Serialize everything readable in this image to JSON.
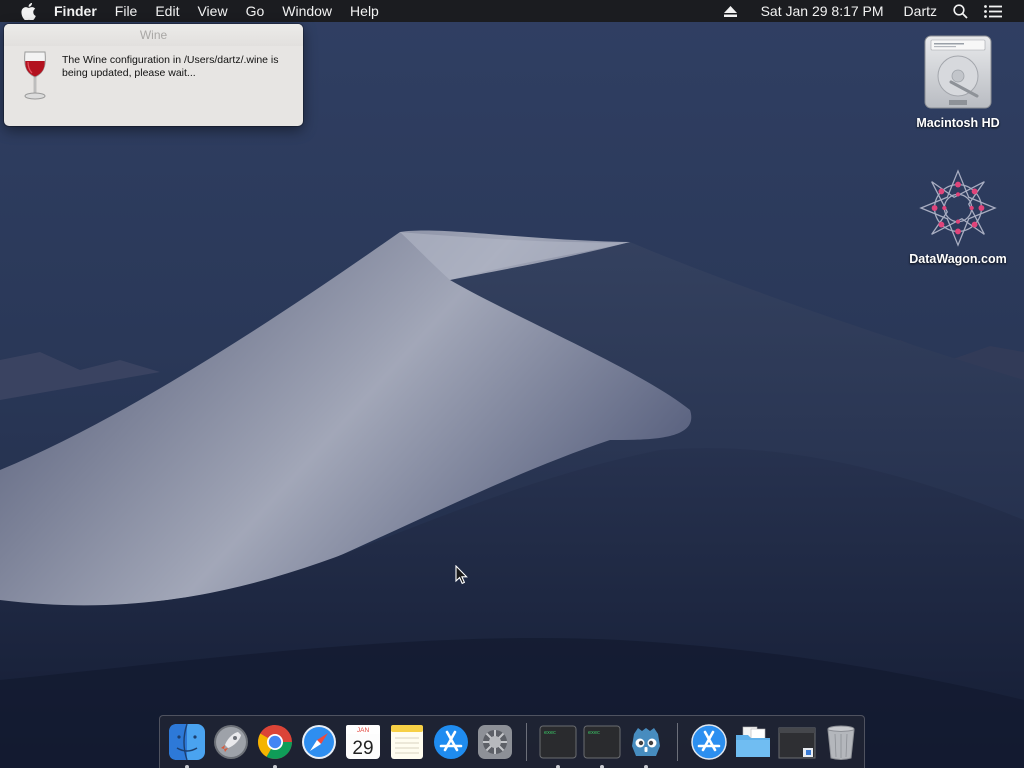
{
  "menubar": {
    "app_name": "Finder",
    "menus": [
      "File",
      "Edit",
      "View",
      "Go",
      "Window",
      "Help"
    ],
    "datetime": "Sat Jan 29  8:17 PM",
    "user": "Dartz",
    "icons": [
      "apple-icon",
      "eject-icon",
      "search-icon",
      "notification-center-icon"
    ]
  },
  "wine_dialog": {
    "title": "Wine",
    "message": "The Wine configuration in /Users/dartz/.wine is being updated, please wait...",
    "icon": "wine-glass-icon"
  },
  "desktop_icons": [
    {
      "label": "Macintosh HD",
      "icon": "hard-drive-icon"
    },
    {
      "label": "DataWagon.com",
      "icon": "datawagon-logo-icon"
    }
  ],
  "dock": {
    "apps": [
      {
        "name": "Finder",
        "icon": "finder-icon",
        "running": true
      },
      {
        "name": "Launchpad",
        "icon": "launchpad-icon",
        "running": false
      },
      {
        "name": "Google Chrome",
        "icon": "chrome-icon",
        "running": true
      },
      {
        "name": "Safari",
        "icon": "safari-icon",
        "running": false
      },
      {
        "name": "Calendar",
        "icon": "calendar-icon",
        "running": false,
        "month": "JAN",
        "day": "29"
      },
      {
        "name": "Notes",
        "icon": "notes-icon",
        "running": false
      },
      {
        "name": "App Store",
        "icon": "app-store-icon",
        "running": false
      },
      {
        "name": "System Preferences",
        "icon": "system-preferences-icon",
        "running": false
      },
      {
        "name": "Terminal exec 1",
        "icon": "terminal-exec-icon",
        "running": true,
        "text": "exec"
      },
      {
        "name": "Terminal exec 2",
        "icon": "terminal-exec-icon",
        "running": true,
        "text": "exec"
      },
      {
        "name": "Godot",
        "icon": "godot-icon",
        "running": true
      }
    ],
    "others": [
      {
        "name": "Applications",
        "icon": "applications-folder-icon"
      },
      {
        "name": "Documents",
        "icon": "documents-folder-icon"
      },
      {
        "name": "Downloads",
        "icon": "downloads-stack-icon"
      },
      {
        "name": "Trash",
        "icon": "trash-icon"
      }
    ]
  },
  "colors": {
    "menubar_bg": "#1b1c20",
    "sky": "#2b3a5c",
    "dune_light": "#8d93a8",
    "dune_dark": "#1c2742",
    "dialog_bg": "#e7e5e3"
  }
}
